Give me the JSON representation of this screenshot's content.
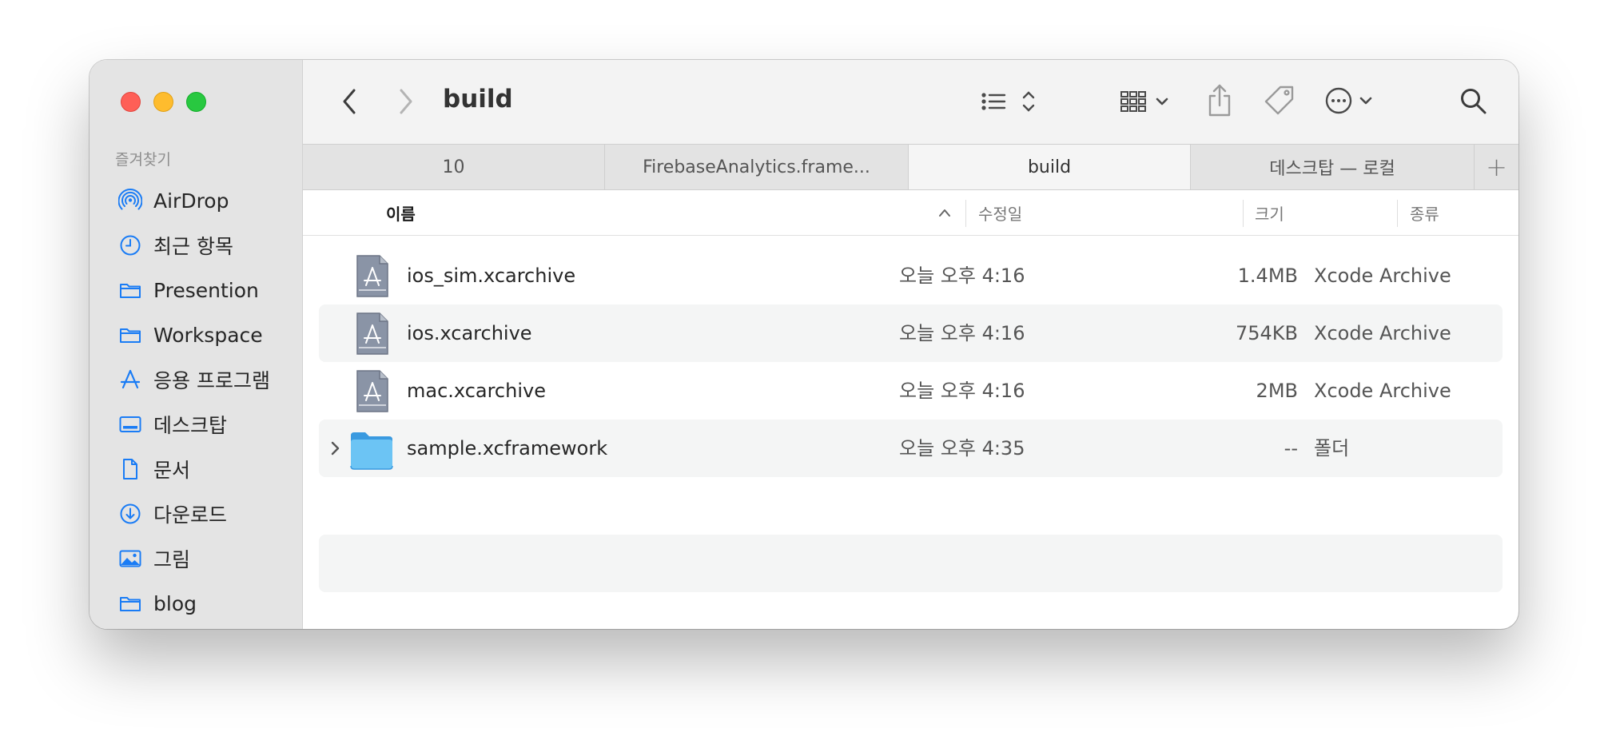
{
  "window": {
    "title": "build"
  },
  "sidebar": {
    "heading": "즐겨찾기",
    "items": [
      {
        "label": "AirDrop",
        "icon": "airdrop-icon"
      },
      {
        "label": "최근 항목",
        "icon": "clock-icon"
      },
      {
        "label": "Presention",
        "icon": "folder-icon"
      },
      {
        "label": "Workspace",
        "icon": "folder-icon"
      },
      {
        "label": "응용 프로그램",
        "icon": "applications-icon"
      },
      {
        "label": "데스크탑",
        "icon": "desktop-icon"
      },
      {
        "label": "문서",
        "icon": "document-icon"
      },
      {
        "label": "다운로드",
        "icon": "download-icon"
      },
      {
        "label": "그림",
        "icon": "pictures-icon"
      },
      {
        "label": "blog",
        "icon": "folder-icon"
      }
    ]
  },
  "tabs": [
    {
      "label": "10",
      "active": false
    },
    {
      "label": "FirebaseAnalytics.frame...",
      "active": false
    },
    {
      "label": "build",
      "active": true
    },
    {
      "label": "데스크탑 — 로컬",
      "active": false
    }
  ],
  "tab_add_label": "+",
  "columns": {
    "name": "이름",
    "date": "수정일",
    "size": "크기",
    "kind": "종류"
  },
  "files": [
    {
      "name": "ios_sim.xcarchive",
      "date": "오늘 오후 4:16",
      "size": "1.4MB",
      "kind": "Xcode Archive",
      "type": "xcarchive"
    },
    {
      "name": "ios.xcarchive",
      "date": "오늘 오후 4:16",
      "size": "754KB",
      "kind": "Xcode Archive",
      "type": "xcarchive"
    },
    {
      "name": "mac.xcarchive",
      "date": "오늘 오후 4:16",
      "size": "2MB",
      "kind": "Xcode Archive",
      "type": "xcarchive"
    },
    {
      "name": "sample.xcframework",
      "date": "오늘 오후 4:35",
      "size": "--",
      "kind": "폴더",
      "type": "folder"
    }
  ],
  "colors": {
    "accent": "#1a7cf5",
    "folder": "#5fb8ef",
    "archive": "#8a94a6"
  }
}
